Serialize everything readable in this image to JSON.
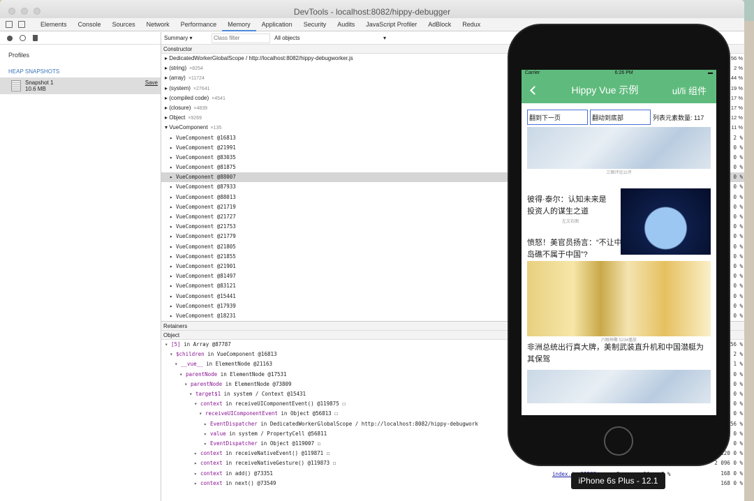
{
  "window": {
    "title": "DevTools - localhost:8082/hippy-debugger"
  },
  "tabs": [
    "Elements",
    "Console",
    "Sources",
    "Network",
    "Performance",
    "Memory",
    "Application",
    "Security",
    "Audits",
    "JavaScript Profiler",
    "AdBlock",
    "Redux"
  ],
  "sidebar": {
    "profiles": "Profiles",
    "heap_snapshots": "HEAP SNAPSHOTS",
    "snapshot_name": "Snapshot 1",
    "snapshot_size": "10.6 MB",
    "save": "Save"
  },
  "filter": {
    "summary": "Summary",
    "class_filter_placeholder": "Class filter",
    "all_objects": "All objects"
  },
  "constructor_header": "Constructor",
  "constructors": [
    {
      "name": "DedicatedWorkerGlobalScope / http://localhost:8082/hippy-debugworker.js",
      "count": ""
    },
    {
      "name": "(string)",
      "count": "×8254"
    },
    {
      "name": "(array)",
      "count": "×11724"
    },
    {
      "name": "(system)",
      "count": "×27641"
    },
    {
      "name": "(compiled code)",
      "count": "×4541"
    },
    {
      "name": "(closure)",
      "count": "×4839"
    },
    {
      "name": "Object",
      "count": "×9269"
    },
    {
      "name": "VueComponent",
      "count": "×135"
    }
  ],
  "vue_components": [
    "VueComponent @16813",
    "VueComponent @21991",
    "VueComponent @83035",
    "VueComponent @81875",
    "VueComponent @88007",
    "VueComponent @87933",
    "VueComponent @88013",
    "VueComponent @21719",
    "VueComponent @21727",
    "VueComponent @21753",
    "VueComponent @21779",
    "VueComponent @21805",
    "VueComponent @21855",
    "VueComponent @21901",
    "VueComponent @81497",
    "VueComponent @83121",
    "VueComponent @15441",
    "VueComponent @17939",
    "VueComponent @18231"
  ],
  "right_pct": [
    "56 %",
    "2 %",
    "44 %",
    "19 %",
    "17 %",
    "17 %",
    "12 %",
    "11 %",
    "2 %",
    "0 %",
    "0 %",
    "0 %",
    "0 %",
    "0 %",
    "0 %",
    "0 %",
    "0 %",
    "0 %",
    "0 %",
    "0 %",
    "0 %",
    "0 %",
    "0 %",
    "0 %",
    "0 %",
    "0 %",
    "0 %"
  ],
  "retainers_header": "Retainers",
  "object_header": "Object",
  "retainers": [
    {
      "key": "[5]",
      "rest": " in Array @87787"
    },
    {
      "key": "$children",
      "rest": " in VueComponent @16813"
    },
    {
      "key": "__vue__",
      "rest": " in ElementNode @21163"
    },
    {
      "key": "parentNode",
      "rest": " in ElementNode @17531"
    },
    {
      "key": "parentNode",
      "rest": " in ElementNode @73809"
    },
    {
      "key": "target$1",
      "rest": " in system / Context @15431"
    },
    {
      "key": "context",
      "rest": " in receiveUIComponentEvent() @119875 ☐"
    },
    {
      "key": "receiveUIComponentEvent",
      "rest": " in Object @56813 ☐"
    },
    {
      "key": "EventDispatcher",
      "rest": " in DedicatedWorkerGlobalScope / http://localhost:8082/hippy-debugwork"
    },
    {
      "key": "value",
      "rest": " in system / PropertyCell @56811"
    },
    {
      "key": "EventDispatcher",
      "rest": " in Object @119007 ☐"
    },
    {
      "key": "context",
      "rest": " in receiveNativeEvent() @119871 ☐"
    },
    {
      "key": "context",
      "rest": " in receiveNativeGesture() @119873 ☐"
    },
    {
      "key": "context",
      "rest": " in add() @73351"
    },
    {
      "key": "context",
      "rest": " in next() @73549"
    }
  ],
  "ret_right": [
    "56 %",
    "2 %",
    "1 %",
    "0 %",
    "0 %",
    "0 %",
    "0 %",
    "0 %",
    "56 %",
    "0 %",
    "0 %",
    "120 0 %",
    "2 096 0 %",
    "168 0 %",
    "168 0 %"
  ],
  "ret_bottom": [
    {
      "src": "index.js:11562",
      "a": "3",
      "b": "64",
      "c": "0 %"
    }
  ],
  "phone": {
    "carrier": "Carrier",
    "time": "6:26 PM",
    "nav_title": "Hippy Vue 示例",
    "nav_right": "ul/li 组件",
    "btn_next": "翻到下一页",
    "btn_bottom": "翻动到底部",
    "count_label": "列表元素数量: 117",
    "cap1": "三图评论11评",
    "article1": "彼得·泰尔：认知未来是投资人的谋生之道",
    "cap2": "左文右图",
    "article2": "愤怒！美官员扬言：“不让中国拿走南海的岛屿，南海岛礁不属于中国”?",
    "cap3": "六眼神聚 5234播放",
    "article3": "非洲总统出行真大牌，美制武装直升机和中国潜艇为其保驾"
  },
  "device_label": "iPhone 6s Plus - 12.1"
}
